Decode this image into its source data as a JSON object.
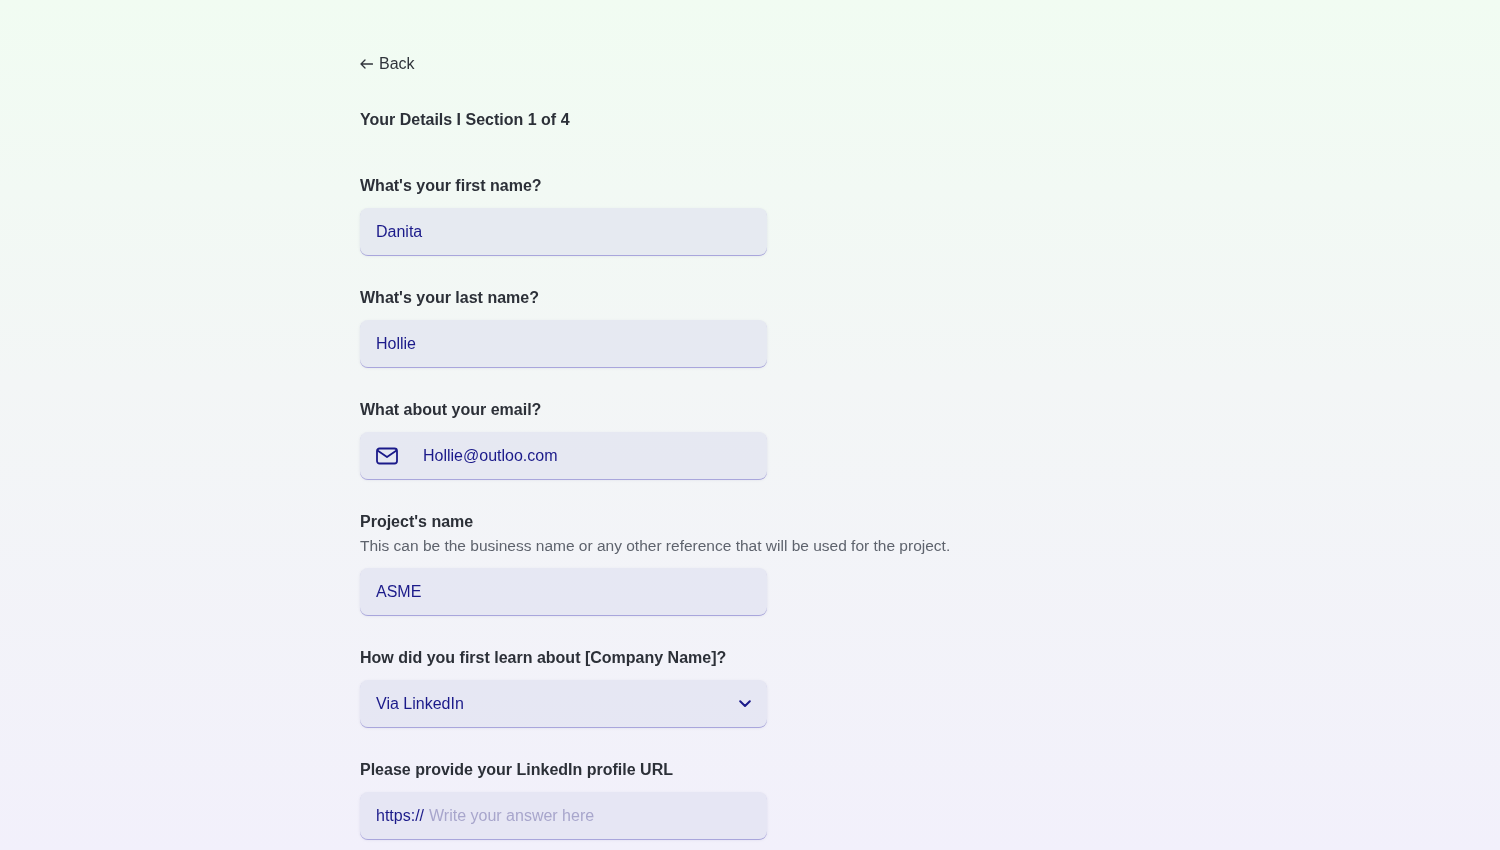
{
  "back_link": {
    "label": "Back"
  },
  "section_title": "Your Details I Section 1 of 4",
  "fields": [
    {
      "kind": "text",
      "label": "What's your first name?",
      "value": "Danita"
    },
    {
      "kind": "text",
      "label": "What's your last name?",
      "value": "Hollie"
    },
    {
      "kind": "email",
      "label": "What about your email?",
      "value": "Hollie@outloo.com"
    },
    {
      "kind": "text",
      "label": "Project's name",
      "description": "This can be the business name or any other reference that will be used for the project.",
      "value": "ASME"
    },
    {
      "kind": "select",
      "label": "How did you first learn about [Company Name]?",
      "value": "Via LinkedIn"
    },
    {
      "kind": "url",
      "label": "Please provide your LinkedIn profile URL",
      "prefix": "https://",
      "placeholder": "Write your answer here"
    }
  ]
}
